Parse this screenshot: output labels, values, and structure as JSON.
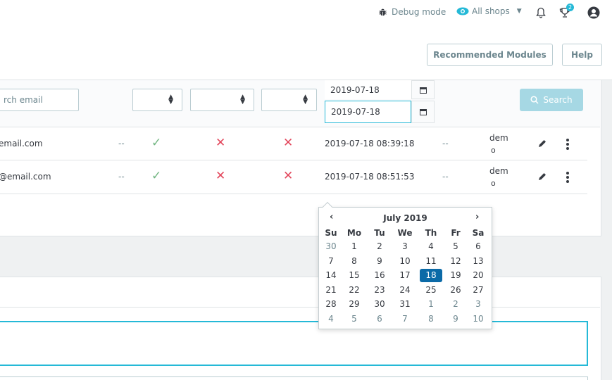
{
  "header": {
    "debug_label": "Debug mode",
    "shops_label": "All shops",
    "notification_badge": "2"
  },
  "toolbar": {
    "recommended_label": "Recommended Modules",
    "help_label": "Help"
  },
  "filters": {
    "email_placeholder": "rch email",
    "date_from": "2019-07-18",
    "date_to": "2019-07-18",
    "search_label": "Search"
  },
  "rows": [
    {
      "email": "email.com",
      "dash1": "--",
      "date": "2019-07-18 08:39:18",
      "dash2": "--",
      "emp_line1": "dem",
      "emp_line2": "o"
    },
    {
      "email": "@email.com",
      "dash1": "--",
      "date": "2019-07-18 08:51:53",
      "dash2": "--",
      "emp_line1": "dem",
      "emp_line2": "o"
    }
  ],
  "datepicker": {
    "title": "July 2019",
    "prev": "‹",
    "next": "›",
    "weekdays": [
      "Su",
      "Mo",
      "Tu",
      "We",
      "Th",
      "Fr",
      "Sa"
    ],
    "weeks": [
      [
        "30",
        "1",
        "2",
        "3",
        "4",
        "5",
        "6"
      ],
      [
        "7",
        "8",
        "9",
        "10",
        "11",
        "12",
        "13"
      ],
      [
        "14",
        "15",
        "16",
        "17",
        "18",
        "19",
        "20"
      ],
      [
        "21",
        "22",
        "23",
        "24",
        "25",
        "26",
        "27"
      ],
      [
        "28",
        "29",
        "30",
        "31",
        "1",
        "2",
        "3"
      ],
      [
        "4",
        "5",
        "6",
        "7",
        "8",
        "9",
        "10"
      ]
    ],
    "selected": "18"
  },
  "colors": {
    "accent": "#25b9d7",
    "selected_day": "#0b6aa7",
    "success": "#70b580",
    "danger": "#e3495e"
  }
}
